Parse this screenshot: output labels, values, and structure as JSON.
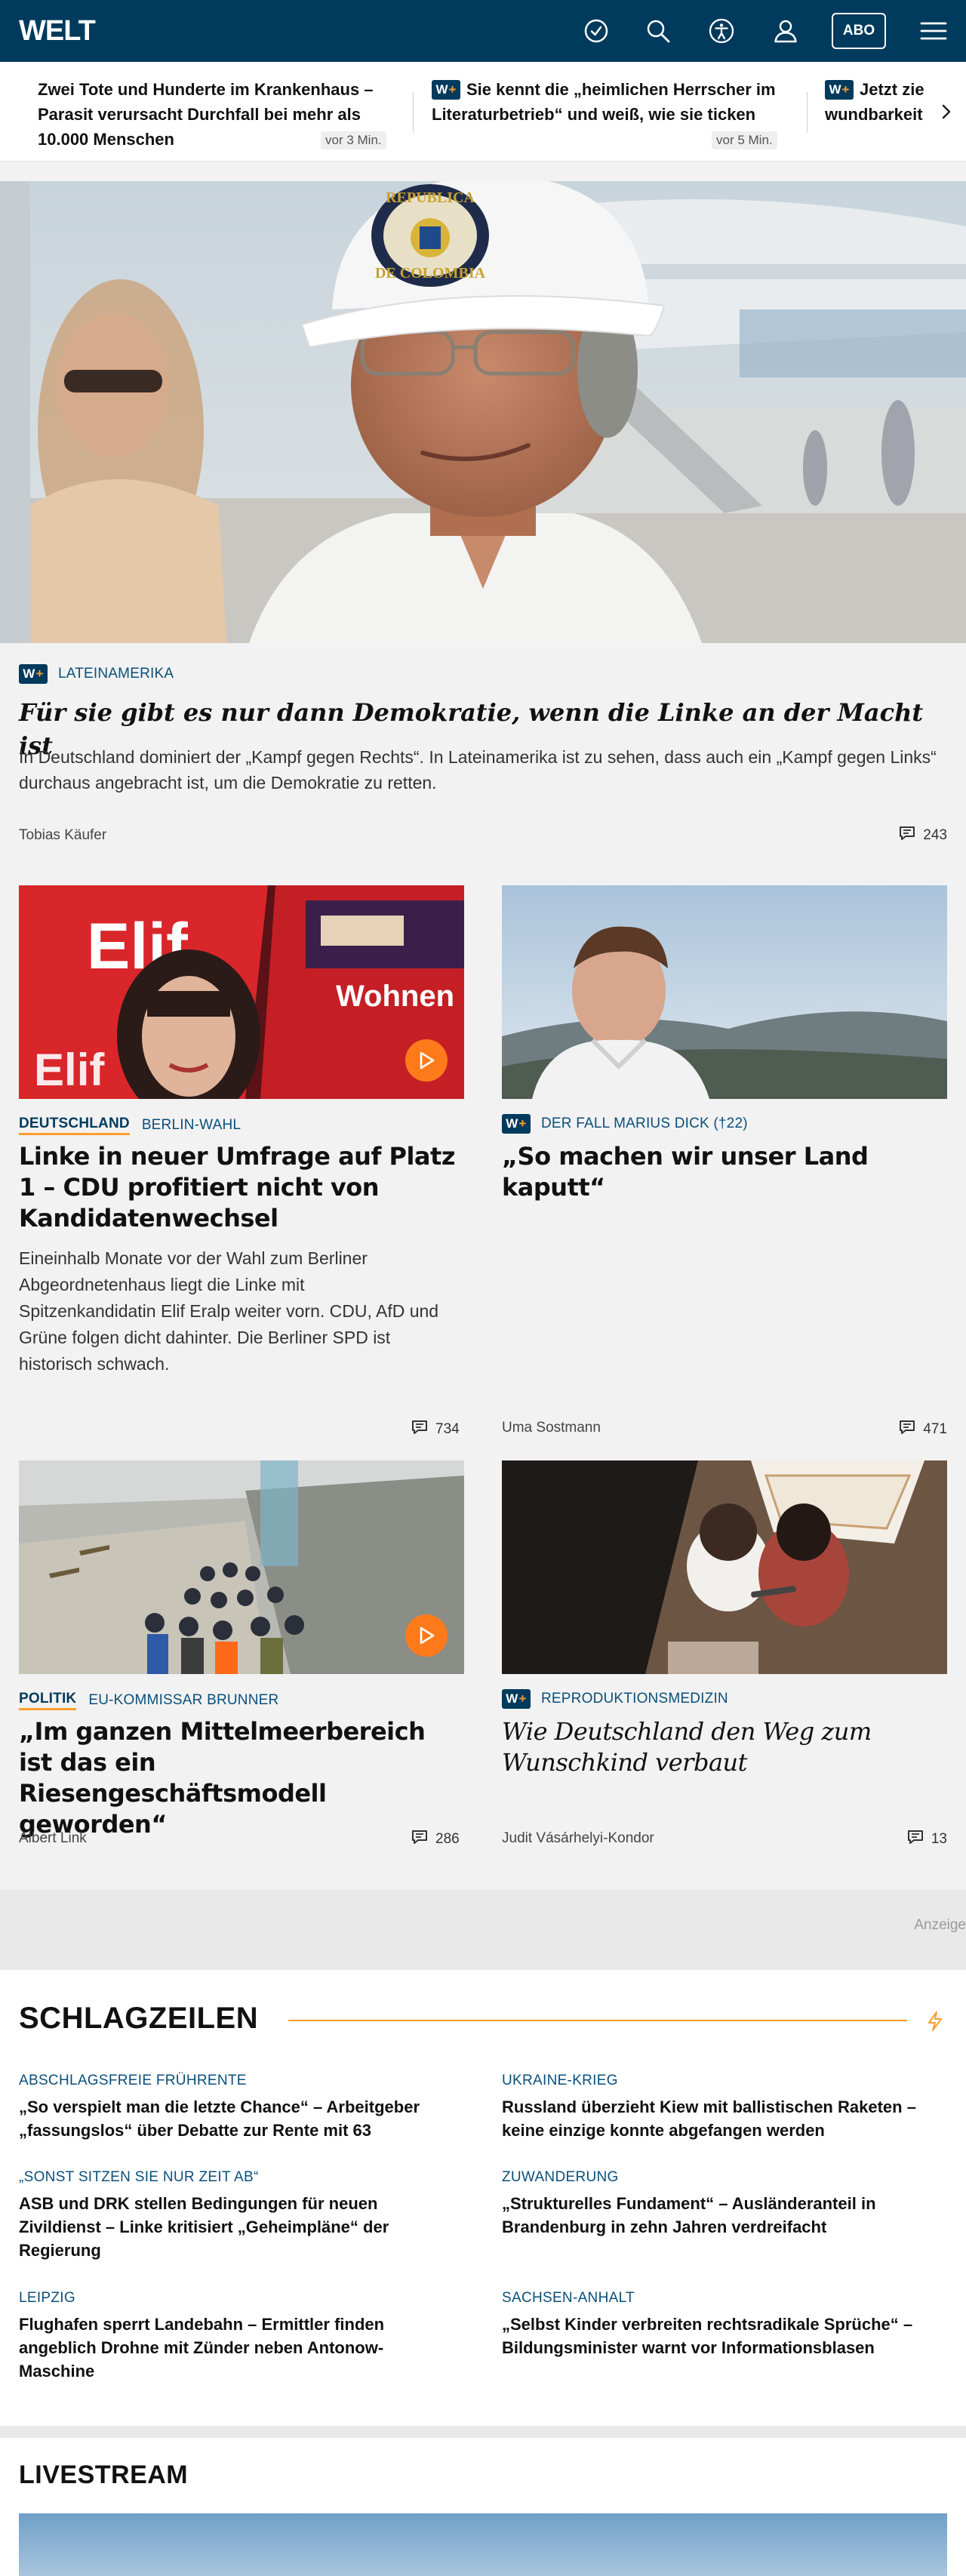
{
  "header": {
    "logo": "WELT",
    "abo_label": "ABO",
    "icons": [
      "clock-icon",
      "search-icon",
      "accessibility-icon",
      "user-icon",
      "menu-icon"
    ]
  },
  "ticker": {
    "items": [
      {
        "title": "Zwei Tote und Hunderte im Krankenhaus – Parasit verursacht Durchfall bei mehr als 10.000 Menschen",
        "time": "vor 3 Min.",
        "premium": false
      },
      {
        "title": "Sie kennt die „heimlichen Herrscher im Literaturbetrieb“ und weiß, wie sie ticken",
        "time": "vor 5 Min.",
        "premium": true
      },
      {
        "title": "Jetzt zie wundbarkeit",
        "premium": true
      }
    ]
  },
  "premium_badge": {
    "w": "W",
    "plus": "+"
  },
  "hero": {
    "kicker": "LATEINAMERIKA",
    "title": "Für sie gibt es nur dann Demokratie, wenn die Linke an der Macht ist",
    "description": "In Deutschland dominiert der „Kampf gegen Rechts“. In Lateinamerika ist zu sehen, dass auch ein „Kampf gegen Links“ durchaus angebracht ist, um die Demokratie zu retten.",
    "author": "Tobias Käufer",
    "comments": "243",
    "cap_text_1": "REPUBLICA",
    "cap_text_2": "DE COLOMBIA"
  },
  "cards": [
    {
      "kicker_main": "DEUTSCHLAND",
      "kicker": "BERLIN-WAHL",
      "title": "Linke in neuer Umfrage auf Platz 1 – CDU profitiert nicht von Kandidatenwechsel",
      "description": "Eineinhalb Monate vor der Wahl zum Berliner Abgeordnetenhaus liegt die Linke mit Spitzenkandidatin Elif Eralp weiter vorn. CDU, AfD und Grüne folgen dicht dahinter. Die Berliner SPD ist historisch schwach.",
      "comments": "734",
      "mag_text": "Elif",
      "mag_text2": "Wohnen"
    },
    {
      "kicker": "DER FALL MARIUS DICK (†22)",
      "title": "„So machen wir unser Land kaputt“",
      "author": "Uma Sostmann",
      "comments": "471"
    },
    {
      "kicker_main": "POLITIK",
      "kicker": "EU-KOMMISSAR BRUNNER",
      "title": "„Im ganzen Mittelmeerbereich ist das ein Riesengeschäftsmodell geworden“",
      "author": "Albert Link",
      "comments": "286"
    },
    {
      "kicker": "REPRODUKTIONSMEDIZIN",
      "title": "Wie Deutschland den Weg zum Wunschkind verbaut",
      "author": "Judit Vásárhelyi-Kondor",
      "comments": "13"
    }
  ],
  "ad_label": "Anzeige",
  "schlagzeilen": {
    "title": "SCHLAGZEILEN",
    "items": [
      {
        "kicker": "ABSCHLAGSFREIE FRÜHRENTE",
        "title": "„So verspielt man die letzte Chance“ – Arbeitgeber „fassungslos“ über Debatte zur Rente mit 63"
      },
      {
        "kicker": "UKRAINE-KRIEG",
        "title": "Russland überzieht Kiew mit ballistischen Raketen – keine einzige konnte abgefangen werden"
      },
      {
        "kicker": "„SONST SITZEN SIE NUR ZEIT AB“",
        "title": "ASB und DRK stellen Bedingungen für neuen Zivildienst – Linke kritisiert „Geheimpläne“ der Regierung"
      },
      {
        "kicker": "ZUWANDERUNG",
        "title": "„Strukturelles Fundament“ – Ausländeranteil in Brandenburg in zehn Jahren verdreifacht"
      },
      {
        "kicker": "LEIPZIG",
        "title": "Flughafen sperrt Landebahn – Ermittler finden angeblich Drohne mit Zünder neben Antonow-Maschine"
      },
      {
        "kicker": "SACHSEN-ANHALT",
        "title": "„Selbst Kinder verbreiten rechtsradikale Sprüche“ – Bildungsminister warnt vor Informationsblasen"
      }
    ]
  },
  "livestream": {
    "title": "LIVESTREAM"
  },
  "colors": {
    "brand": "#003a5c",
    "accent": "#ff9d2c",
    "play": "#ff7a1a"
  }
}
